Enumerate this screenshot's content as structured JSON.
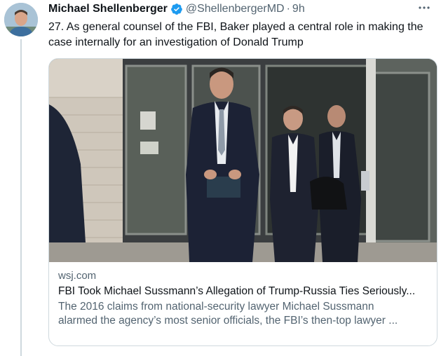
{
  "author": {
    "display_name": "Michael Shellenberger",
    "handle": "@ShellenbergerMD",
    "separator": "·",
    "time": "9h",
    "verified": true
  },
  "tweet": {
    "text_line1": "27. As general counsel of the FBI, Baker played a central role in making the",
    "text_line2": "case internally for an investigation of Donald Trump"
  },
  "card": {
    "domain": "wsj.com",
    "title": "FBI Took Michael Sussmann’s Allegation of Trump-Russia Ties Seriously...",
    "desc_line1": "The 2016 claims from national-security lawyer Michael Sussmann",
    "desc_line2": "alarmed the agency’s most senior officials, the FBI’s then-top lawyer ..."
  },
  "icons": {
    "more": "more-options-icon",
    "verified": "verified-badge-icon"
  },
  "colors": {
    "text": "#0f1419",
    "muted": "#536471",
    "border": "#cfd9de",
    "verified_blue": "#1d9bf0"
  }
}
